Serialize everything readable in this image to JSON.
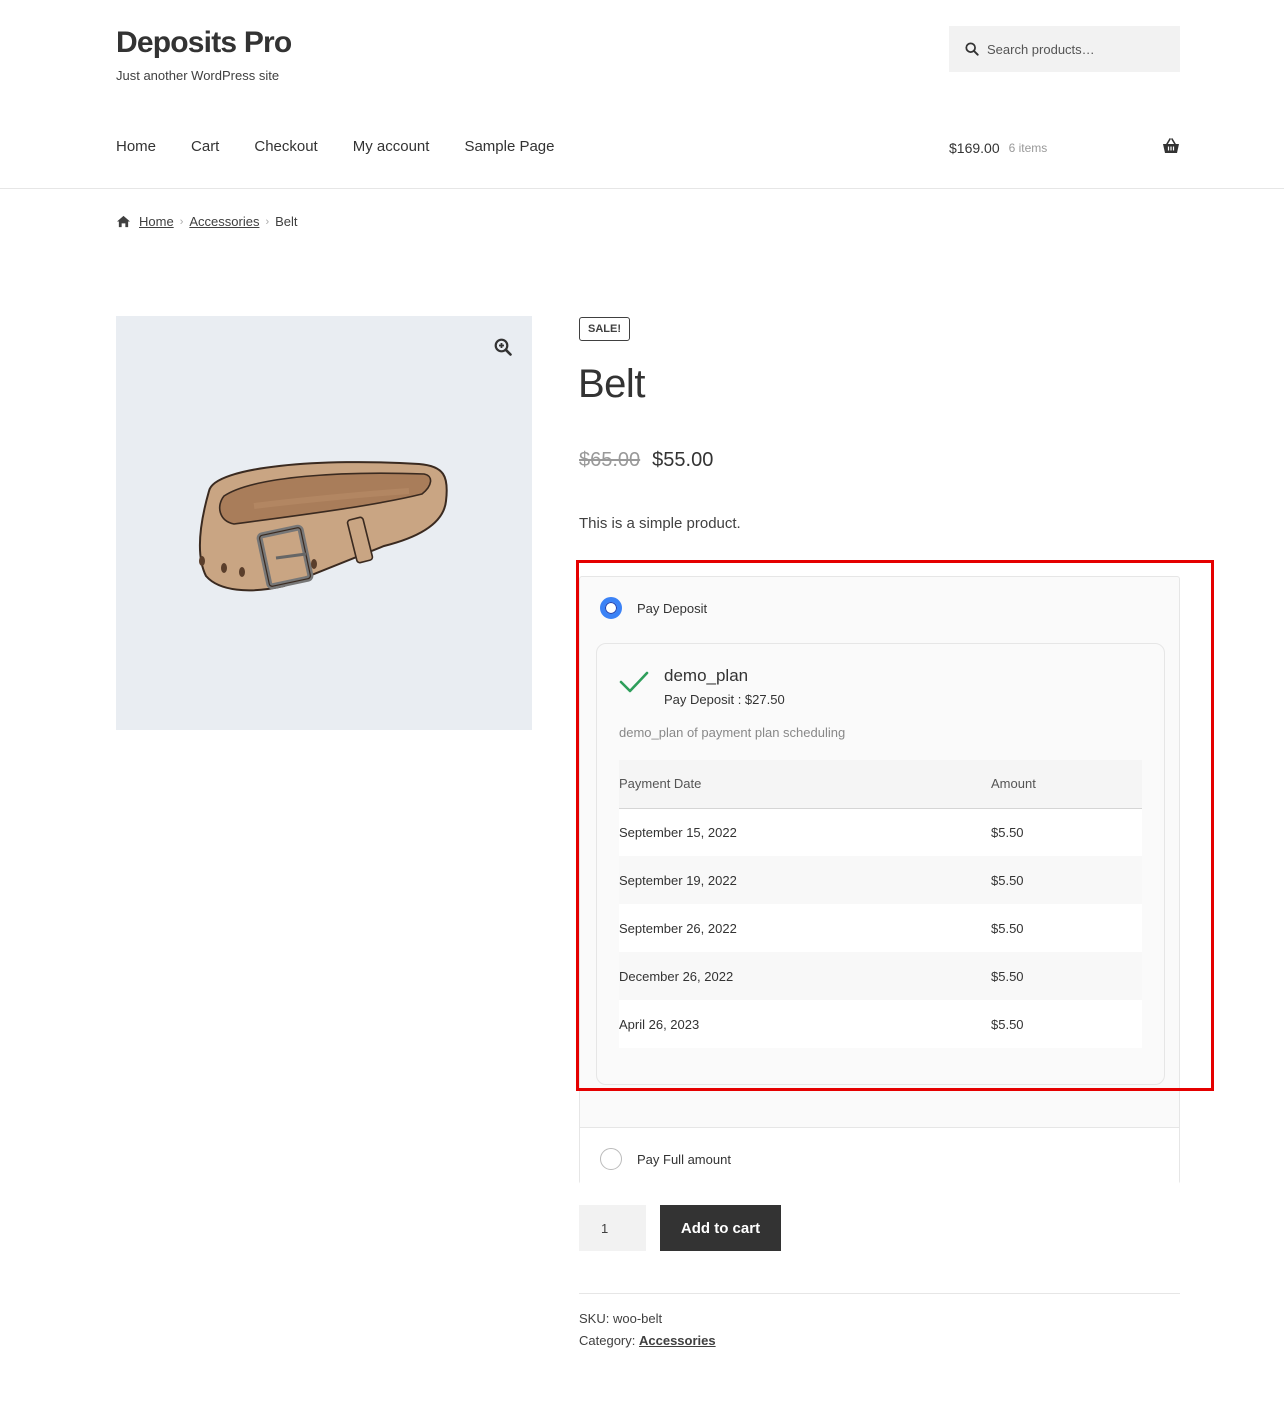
{
  "site": {
    "title": "Deposits Pro",
    "tagline": "Just another WordPress site"
  },
  "search": {
    "placeholder": "Search products…"
  },
  "nav": {
    "items": [
      "Home",
      "Cart",
      "Checkout",
      "My account",
      "Sample Page"
    ]
  },
  "cart": {
    "total": "$169.00",
    "count": "6 items"
  },
  "breadcrumb": {
    "home": "Home",
    "category": "Accessories",
    "current": "Belt"
  },
  "product": {
    "badge": "SALE!",
    "title": "Belt",
    "old_price": "$65.00",
    "price": "$55.00",
    "description": "This is a simple product."
  },
  "deposit": {
    "pay_deposit_label": "Pay Deposit",
    "pay_deposit_selected": true,
    "plan": {
      "name": "demo_plan",
      "deposit": "Pay Deposit : $27.50",
      "description": "demo_plan of payment plan scheduling",
      "headers": [
        "Payment Date",
        "Amount"
      ],
      "rows": [
        [
          "September 15, 2022",
          "$5.50"
        ],
        [
          "September 19, 2022",
          "$5.50"
        ],
        [
          "September 26, 2022",
          "$5.50"
        ],
        [
          "December 26, 2022",
          "$5.50"
        ],
        [
          "April 26, 2023",
          "$5.50"
        ]
      ]
    },
    "pay_full_label": "Pay Full amount"
  },
  "purchase": {
    "quantity": "1",
    "add_to_cart_label": "Add to cart"
  },
  "meta": {
    "sku_label": "SKU:",
    "sku_value": "woo-belt",
    "category_label": "Category:",
    "category_value": "Accessories"
  },
  "colors": {
    "highlight": "#e50000",
    "radio_selected": "#3b82f6",
    "check": "#2e9e5b",
    "button": "#333333"
  }
}
